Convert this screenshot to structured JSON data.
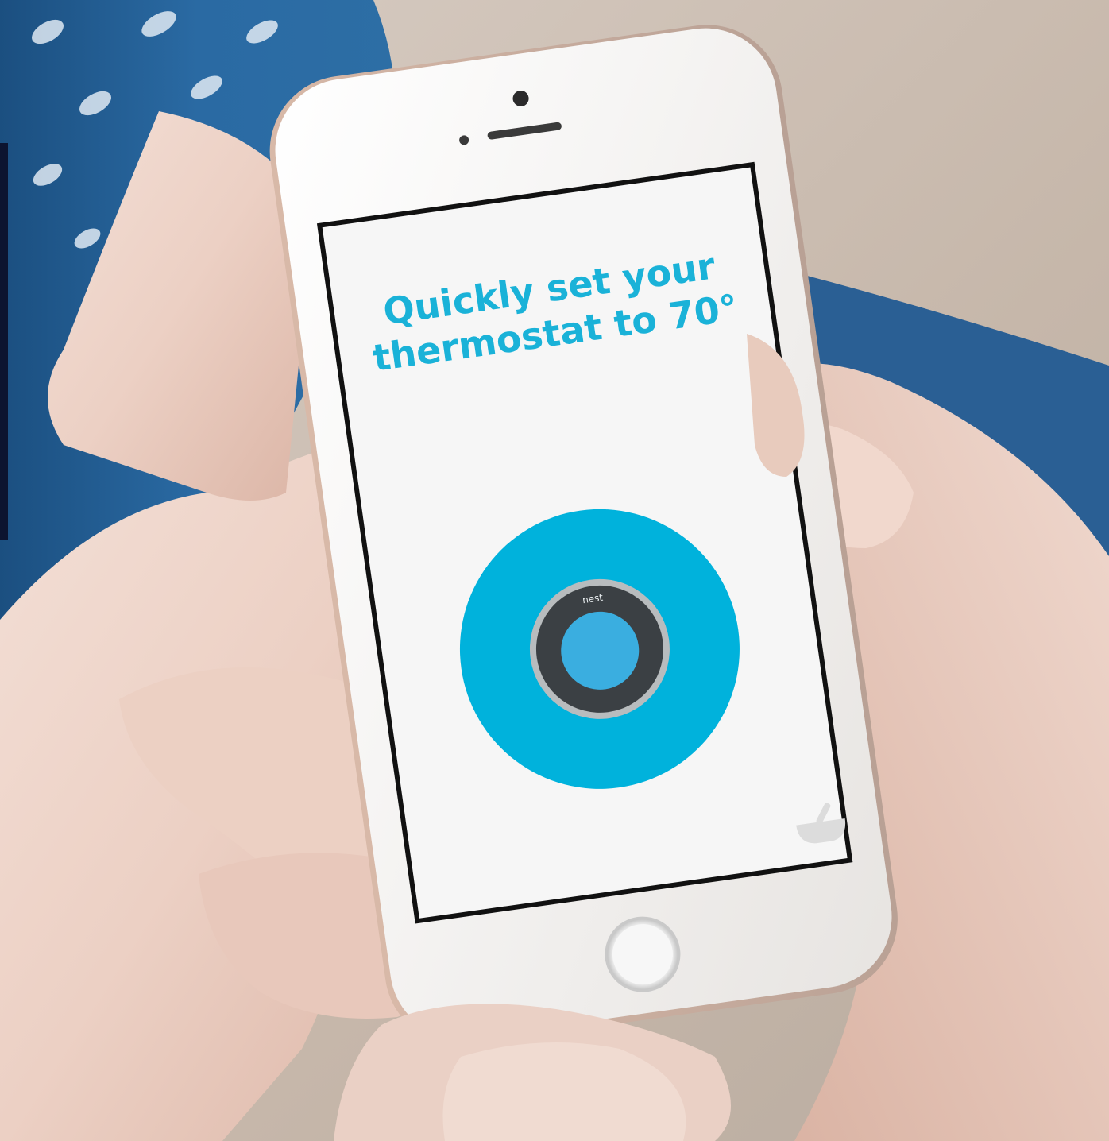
{
  "screen": {
    "headline_line1": "Quickly set your",
    "headline_line2": "thermostat to 70°",
    "thermostat_brand": "nest",
    "corner_icon": "mortar-pestle-icon"
  },
  "colors": {
    "accent": "#00b2dc",
    "thermostat_ring": "#b8bcbe",
    "thermostat_face": "#3b4044",
    "thermostat_display": "#3aaee0",
    "screen_bg": "#f6f6f6",
    "phone_body": "#f4f3f1",
    "headline": "#1ab2d8"
  }
}
